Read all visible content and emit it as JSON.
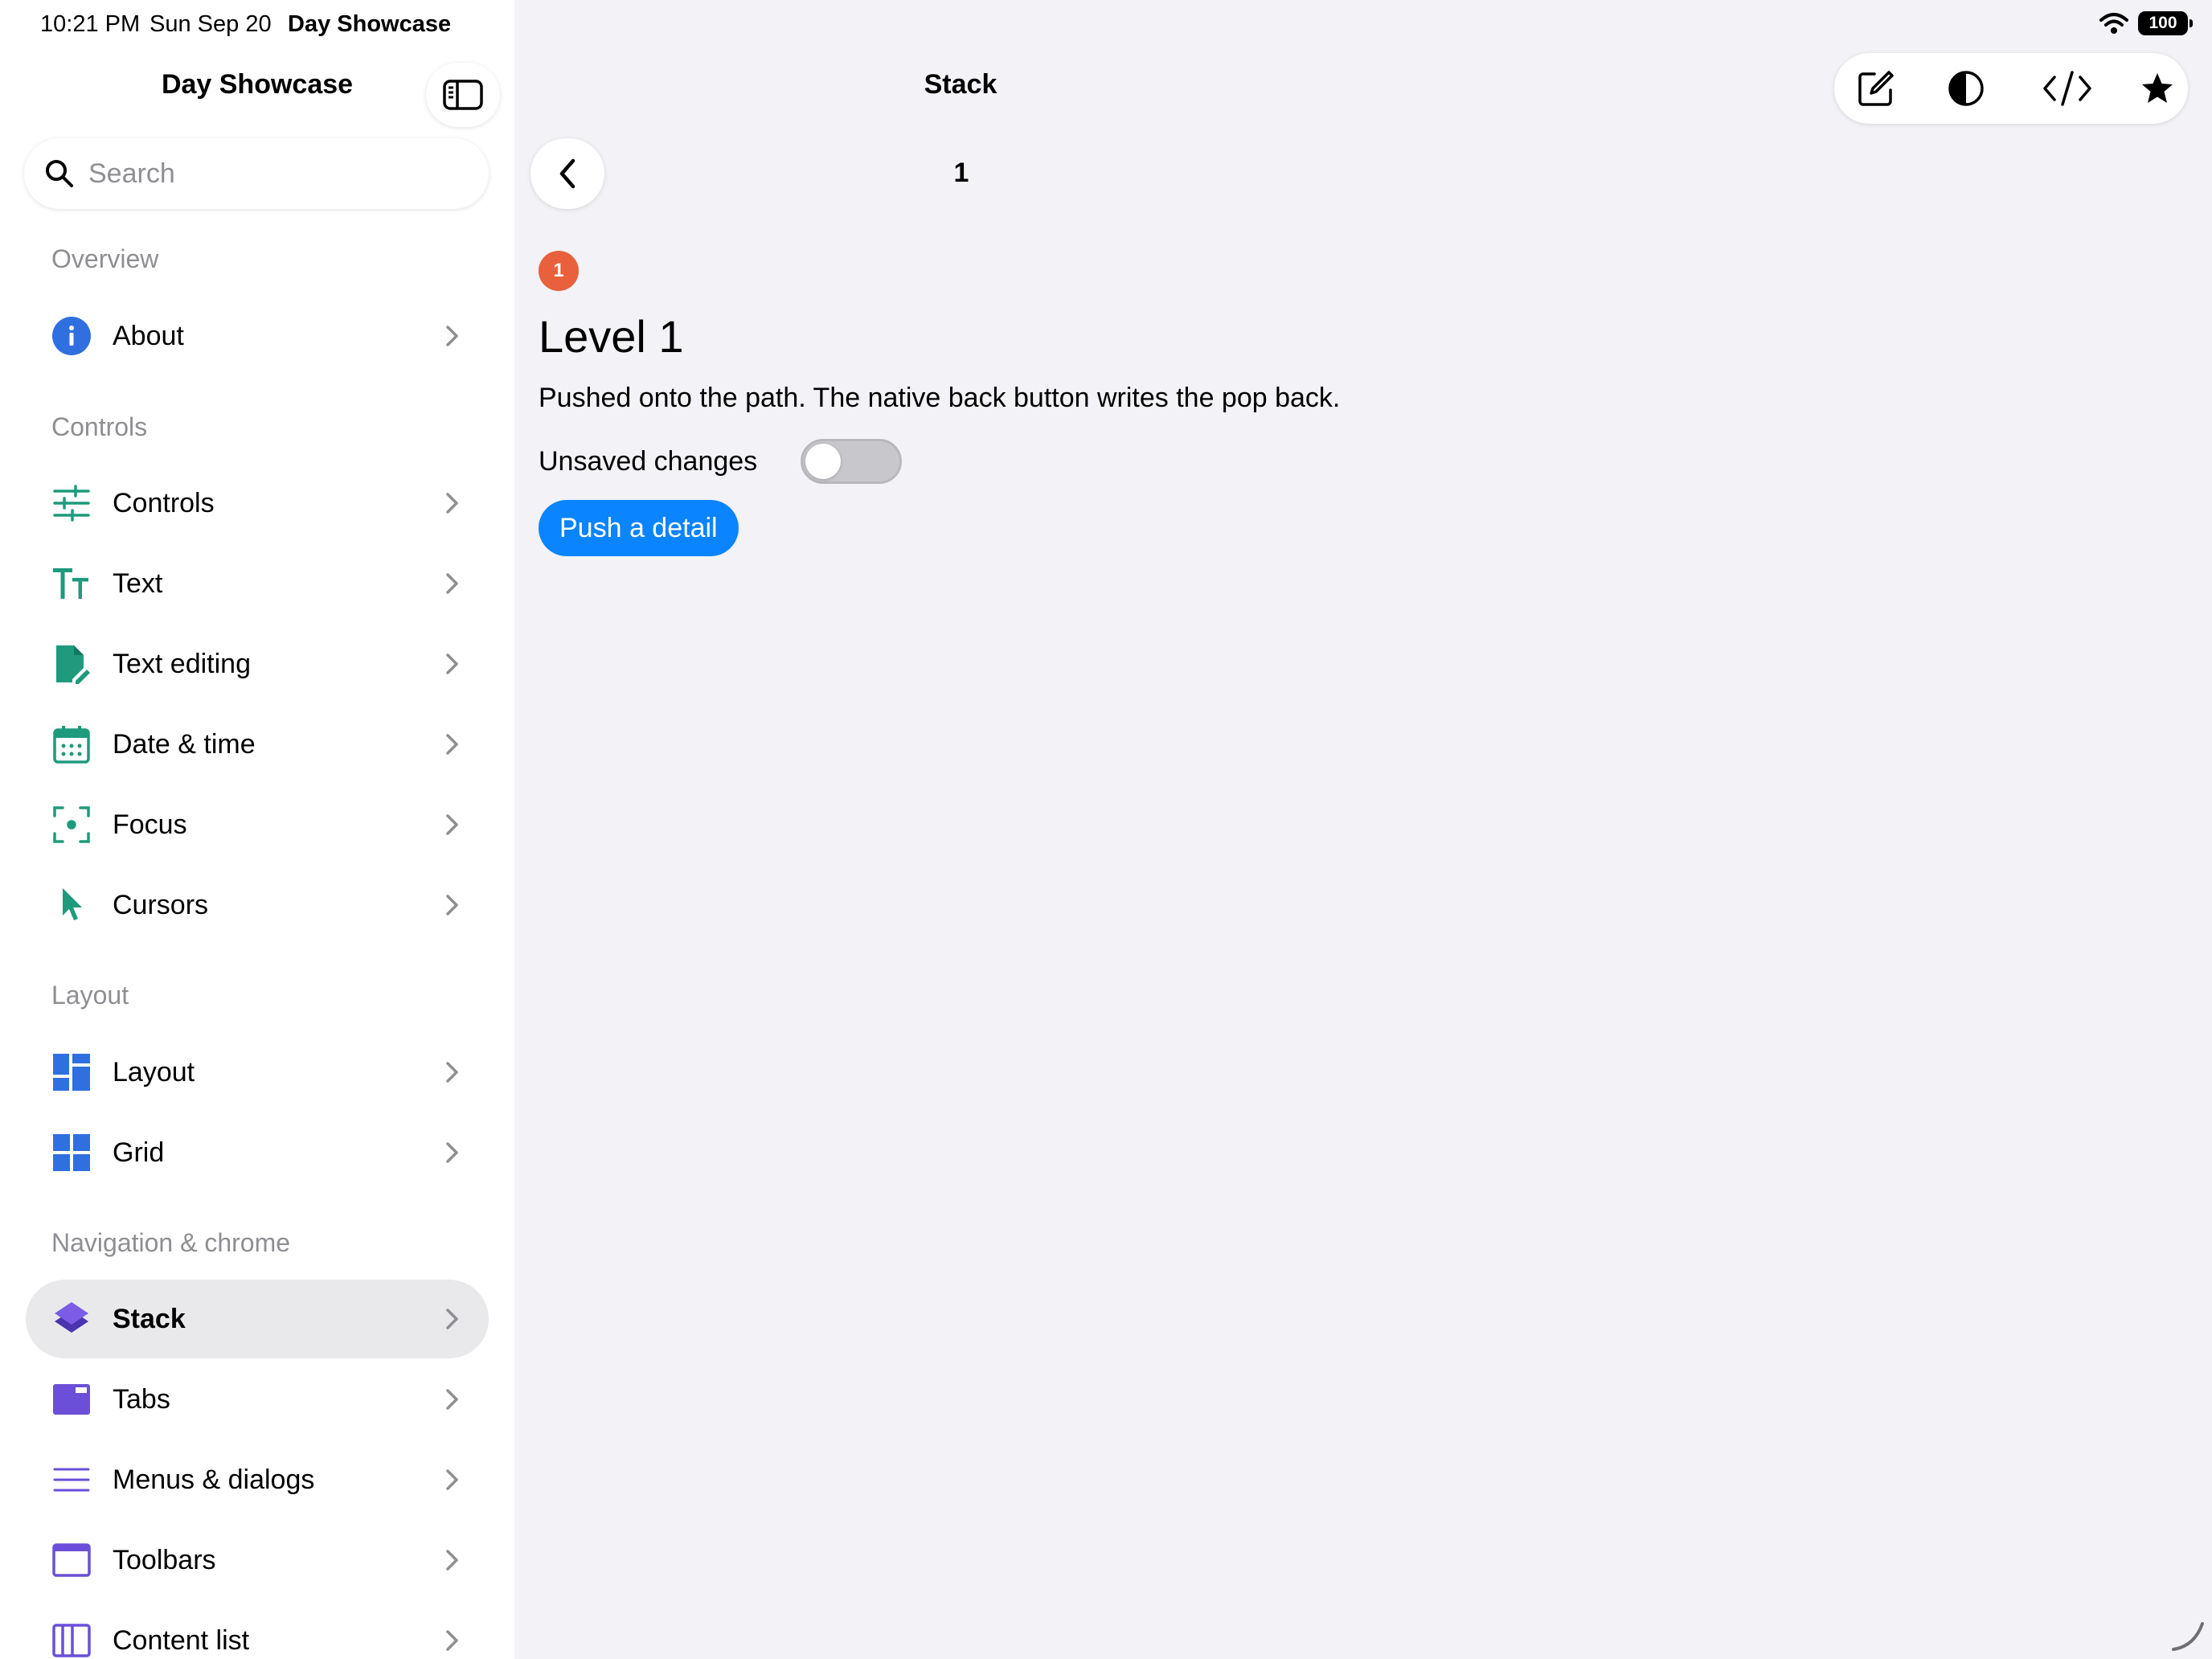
{
  "status_bar": {
    "time": "10:21 PM",
    "date": "Sun Sep 20",
    "app": "Day Showcase",
    "battery": "100"
  },
  "sidebar": {
    "title": "Day Showcase",
    "search_placeholder": "Search",
    "sections": [
      {
        "label": "Overview",
        "items": [
          {
            "label": "About",
            "icon": "info-icon",
            "color": "#2f6fe0"
          }
        ]
      },
      {
        "label": "Controls",
        "items": [
          {
            "label": "Controls",
            "icon": "sliders-icon",
            "color": "#1f9a7c"
          },
          {
            "label": "Text",
            "icon": "text-size-icon",
            "color": "#1f9a7c"
          },
          {
            "label": "Text editing",
            "icon": "document-edit-icon",
            "color": "#1f9a7c"
          },
          {
            "label": "Date & time",
            "icon": "calendar-icon",
            "color": "#1f9a7c"
          },
          {
            "label": "Focus",
            "icon": "focus-icon",
            "color": "#1f9a7c"
          },
          {
            "label": "Cursors",
            "icon": "cursor-icon",
            "color": "#1f9a7c"
          }
        ]
      },
      {
        "label": "Layout",
        "items": [
          {
            "label": "Layout",
            "icon": "layout-icon",
            "color": "#2f6fe0"
          },
          {
            "label": "Grid",
            "icon": "grid-icon",
            "color": "#2f6fe0"
          }
        ]
      },
      {
        "label": "Navigation & chrome",
        "items": [
          {
            "label": "Stack",
            "icon": "stack-icon",
            "color": "#6b4fd8",
            "selected": true
          },
          {
            "label": "Tabs",
            "icon": "tabs-icon",
            "color": "#6b4fd8"
          },
          {
            "label": "Menus & dialogs",
            "icon": "menu-icon",
            "color": "#6b4fd8"
          },
          {
            "label": "Toolbars",
            "icon": "toolbar-icon",
            "color": "#6b4fd8"
          },
          {
            "label": "Content list",
            "icon": "content-list-icon",
            "color": "#6b4fd8"
          }
        ]
      }
    ]
  },
  "main": {
    "title": "Stack",
    "path_count": "1",
    "badge": "1",
    "level_title": "Level 1",
    "description": "Pushed onto the path. The native back button writes the pop back.",
    "toggle_label": "Unsaved changes",
    "toggle_on": false,
    "push_button": "Push a detail"
  },
  "colors": {
    "accent": "#0a84ff",
    "badge": "#e8603c",
    "teal_icons": "#1f9a7c",
    "blue_icons": "#2f6fe0",
    "purple_icons": "#6b4fd8"
  }
}
